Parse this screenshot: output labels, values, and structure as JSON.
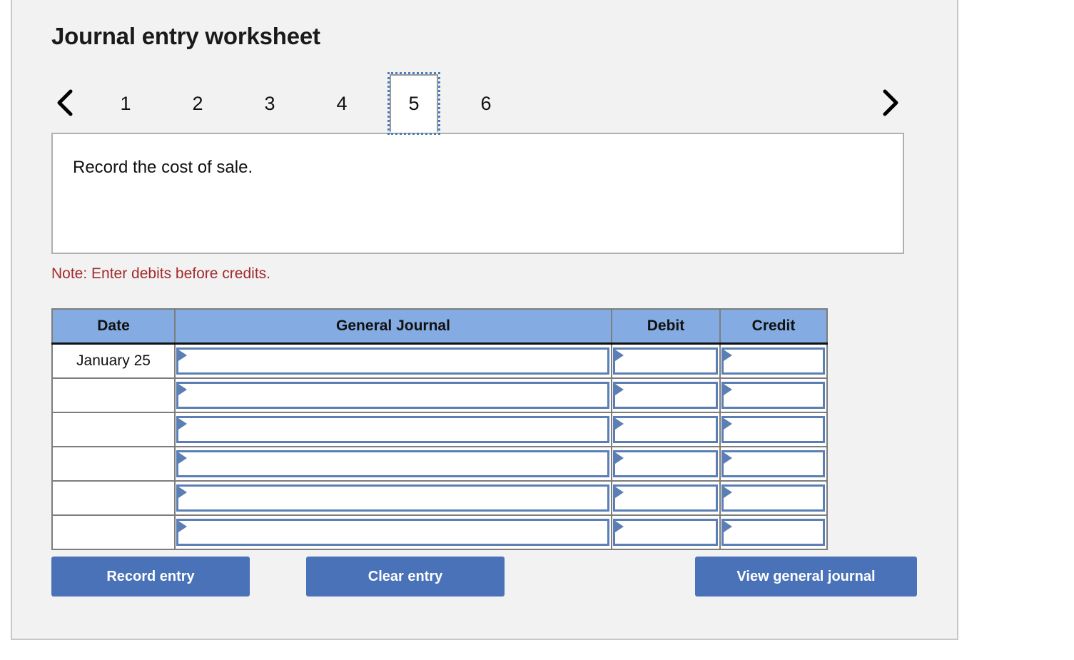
{
  "worksheet": {
    "title": "Journal entry worksheet",
    "prev_icon": "chevron-left-icon",
    "next_icon": "chevron-right-icon",
    "tabs": [
      {
        "label": "1",
        "selected": false
      },
      {
        "label": "2",
        "selected": false
      },
      {
        "label": "3",
        "selected": false
      },
      {
        "label": "4",
        "selected": false
      },
      {
        "label": "5",
        "selected": true
      },
      {
        "label": "6",
        "selected": false
      }
    ],
    "prompt": "Record the cost of sale.",
    "note": "Note: Enter debits before credits."
  },
  "journal": {
    "columns": [
      "Date",
      "General Journal",
      "Debit",
      "Credit"
    ],
    "rows": [
      {
        "date": "January 25",
        "account": "",
        "debit": "",
        "credit": ""
      },
      {
        "date": "",
        "account": "",
        "debit": "",
        "credit": ""
      },
      {
        "date": "",
        "account": "",
        "debit": "",
        "credit": ""
      },
      {
        "date": "",
        "account": "",
        "debit": "",
        "credit": ""
      },
      {
        "date": "",
        "account": "",
        "debit": "",
        "credit": ""
      },
      {
        "date": "",
        "account": "",
        "debit": "",
        "credit": ""
      }
    ]
  },
  "actions": {
    "record_entry": "Record entry",
    "clear_entry": "Clear entry",
    "view_general_journal": "View general journal"
  },
  "colors": {
    "page_background": "#f2f2f2",
    "header_blue": "#84ace2",
    "button_blue": "#4a72b8",
    "field_border_blue": "#5b7fb5",
    "note_red": "#a32b2b",
    "panel_border": "#c8c8c8"
  }
}
